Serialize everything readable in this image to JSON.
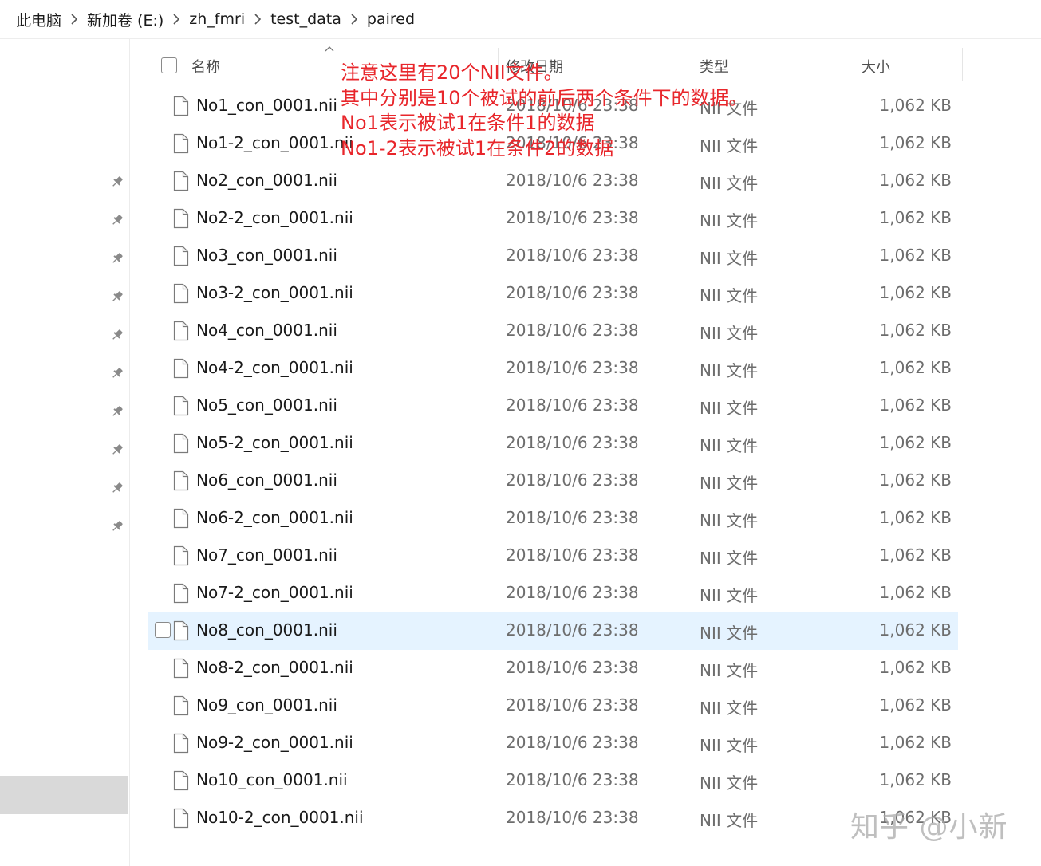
{
  "breadcrumb": {
    "items": [
      {
        "label": "此电脑"
      },
      {
        "label": "新加卷 (E:)"
      },
      {
        "label": "zh_fmri"
      },
      {
        "label": "test_data"
      },
      {
        "label": "paired"
      }
    ]
  },
  "columns": {
    "name": "名称",
    "date": "修改日期",
    "type": "类型",
    "size": "大小"
  },
  "files": [
    {
      "name": "No1_con_0001.nii",
      "date": "2018/10/6 23:38",
      "type": "NII 文件",
      "size": "1,062 KB"
    },
    {
      "name": "No1-2_con_0001.nii",
      "date": "2018/10/6 23:38",
      "type": "NII 文件",
      "size": "1,062 KB"
    },
    {
      "name": "No2_con_0001.nii",
      "date": "2018/10/6 23:38",
      "type": "NII 文件",
      "size": "1,062 KB"
    },
    {
      "name": "No2-2_con_0001.nii",
      "date": "2018/10/6 23:38",
      "type": "NII 文件",
      "size": "1,062 KB"
    },
    {
      "name": "No3_con_0001.nii",
      "date": "2018/10/6 23:38",
      "type": "NII 文件",
      "size": "1,062 KB"
    },
    {
      "name": "No3-2_con_0001.nii",
      "date": "2018/10/6 23:38",
      "type": "NII 文件",
      "size": "1,062 KB"
    },
    {
      "name": "No4_con_0001.nii",
      "date": "2018/10/6 23:38",
      "type": "NII 文件",
      "size": "1,062 KB"
    },
    {
      "name": "No4-2_con_0001.nii",
      "date": "2018/10/6 23:38",
      "type": "NII 文件",
      "size": "1,062 KB"
    },
    {
      "name": "No5_con_0001.nii",
      "date": "2018/10/6 23:38",
      "type": "NII 文件",
      "size": "1,062 KB"
    },
    {
      "name": "No5-2_con_0001.nii",
      "date": "2018/10/6 23:38",
      "type": "NII 文件",
      "size": "1,062 KB"
    },
    {
      "name": "No6_con_0001.nii",
      "date": "2018/10/6 23:38",
      "type": "NII 文件",
      "size": "1,062 KB"
    },
    {
      "name": "No6-2_con_0001.nii",
      "date": "2018/10/6 23:38",
      "type": "NII 文件",
      "size": "1,062 KB"
    },
    {
      "name": "No7_con_0001.nii",
      "date": "2018/10/6 23:38",
      "type": "NII 文件",
      "size": "1,062 KB"
    },
    {
      "name": "No7-2_con_0001.nii",
      "date": "2018/10/6 23:38",
      "type": "NII 文件",
      "size": "1,062 KB"
    },
    {
      "name": "No8_con_0001.nii",
      "date": "2018/10/6 23:38",
      "type": "NII 文件",
      "size": "1,062 KB"
    },
    {
      "name": "No8-2_con_0001.nii",
      "date": "2018/10/6 23:38",
      "type": "NII 文件",
      "size": "1,062 KB"
    },
    {
      "name": "No9_con_0001.nii",
      "date": "2018/10/6 23:38",
      "type": "NII 文件",
      "size": "1,062 KB"
    },
    {
      "name": "No9-2_con_0001.nii",
      "date": "2018/10/6 23:38",
      "type": "NII 文件",
      "size": "1,062 KB"
    },
    {
      "name": "No10_con_0001.nii",
      "date": "2018/10/6 23:38",
      "type": "NII 文件",
      "size": "1,062 KB"
    },
    {
      "name": "No10-2_con_0001.nii",
      "date": "2018/10/6 23:38",
      "type": "NII 文件",
      "size": "1,062 KB"
    }
  ],
  "hovered_row": 14,
  "annotation": {
    "lines": [
      "注意这里有20个NII文件。",
      "其中分别是10个被试的前后两个条件下的数据。",
      "No1表示被试1在条件1的数据",
      "No1-2表示被试1在条件2的数据"
    ],
    "color": "#e8262b"
  },
  "watermark": "知乎 @小新",
  "nav": {
    "pinned_count": 10,
    "selected_color": "#d9d9d9"
  },
  "colors": {
    "hover_row": "#e5f3ff",
    "secondary_text": "#6d6d6d"
  },
  "icons": {
    "breadcrumb_separator": "chevron-right-icon",
    "pin": "pin-icon",
    "file": "file-icon",
    "sort": "sort-up-icon"
  }
}
